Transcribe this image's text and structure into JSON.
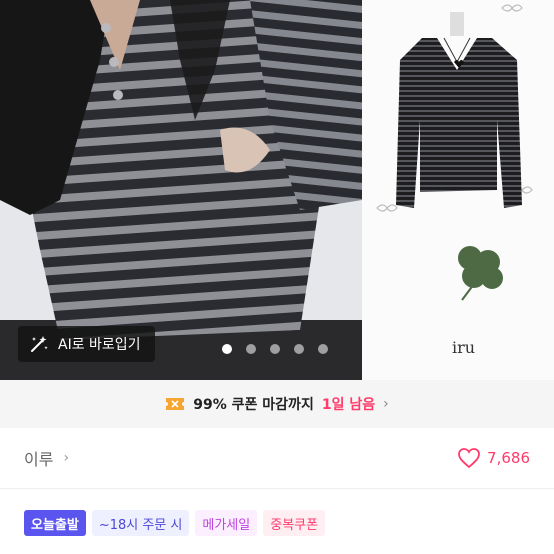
{
  "gallery": {
    "ai_try_label": "AI로 바로입기",
    "page_count": 5,
    "active_page": 1,
    "brand_signature": "iru"
  },
  "coupon": {
    "text": "99% 쿠폰 마감까지",
    "remaining": "1일 남음",
    "accent": "#ff3b6b"
  },
  "store": {
    "name": "이루",
    "like_count": "7,686"
  },
  "badges": {
    "today": "오늘출발",
    "cutoff": "~18시 주문 시",
    "mega": "메가세일",
    "duplicate": "중복쿠폰"
  },
  "colors": {
    "primary": "#5b55ef",
    "accent": "#ff3b6b"
  }
}
